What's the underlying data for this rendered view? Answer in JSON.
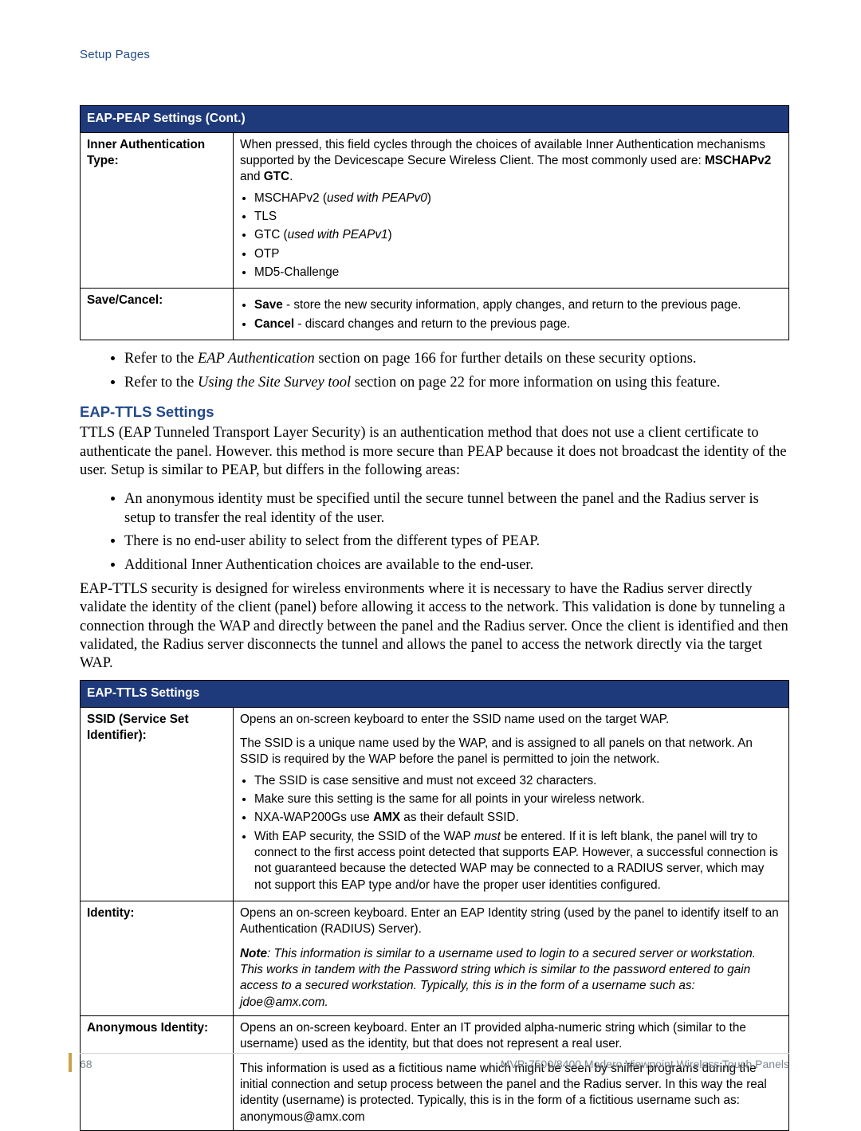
{
  "header": {
    "section_label": "Setup Pages"
  },
  "table1": {
    "title": "EAP-PEAP Settings (Cont.)",
    "rows": {
      "innerAuth": {
        "label": "Inner Authentication Type:",
        "intro_a": "When pressed, this field cycles through the choices of available Inner Authentication mechanisms supported by the Devicescape Secure Wireless Client. The most commonly used are: ",
        "intro_b1": "MSCHAPv2",
        "intro_mid": " and ",
        "intro_b2": "GTC",
        "intro_end": ".",
        "opts": {
          "o1a": "MSCHAPv2 (",
          "o1b": "used with PEAPv0",
          "o1c": ")",
          "o2": "TLS",
          "o3a": "GTC (",
          "o3b": "used with PEAPv1",
          "o3c": ")",
          "o4": "OTP",
          "o5": "MD5-Challenge"
        }
      },
      "saveCancel": {
        "label": "Save/Cancel:",
        "save_b": "Save",
        "save_rest": " - store the new security information, apply changes, and return to the previous page.",
        "cancel_b": "Cancel",
        "cancel_rest": " - discard changes and return to the previous page."
      }
    }
  },
  "afterTable1": {
    "b1a": "Refer to the ",
    "b1i": "EAP Authentication",
    "b1b": " section on page 166 for further details on these security options.",
    "b2a": "Refer to the ",
    "b2i": "Using the Site Survey tool",
    "b2b": " section on page 22 for more information on using this feature."
  },
  "section": {
    "heading": "EAP-TTLS Settings",
    "p1": "TTLS (EAP Tunneled Transport Layer Security) is an authentication method that does not use a client certificate to authenticate the panel. However. this method is more secure than PEAP because it does not broadcast the identity of the user. Setup is similar to PEAP, but differs in the following areas:",
    "b1": "An anonymous identity must be specified until the secure tunnel between the panel and the Radius server is setup to transfer the real identity of the user.",
    "b2": "There is no end-user ability to select from the different types of PEAP.",
    "b3": "Additional Inner Authentication choices are available to the end-user.",
    "p2": "EAP-TTLS security is designed for wireless environments where it is necessary to have the Radius server directly validate the identity of the client (panel) before allowing it access to the network. This validation is done by tunneling a connection through the WAP and directly between the panel and the Radius server. Once the client is identified and then validated, the Radius server disconnects the tunnel and allows the panel to access the network directly via the target WAP."
  },
  "table2": {
    "title": "EAP-TTLS Settings",
    "ssid": {
      "label": "SSID (Service Set Identifier):",
      "p1": "Opens an on-screen keyboard to enter the SSID name used on the target WAP.",
      "p2": "The SSID is a unique name used by the WAP, and is assigned to all panels on that network. An SSID is required by the WAP before the panel is permitted to join the network.",
      "li1": "The SSID is case sensitive and must not exceed 32 characters.",
      "li2": "Make sure this setting is the same for all points in your wireless network.",
      "li3a": "NXA-WAP200Gs use ",
      "li3b": "AMX",
      "li3c": " as their default SSID.",
      "li4a": "With EAP security, the SSID of the WAP ",
      "li4i": "must",
      "li4b": " be entered. If it is left blank, the panel will try to connect to the first access point detected that supports EAP. However, a successful connection is not guaranteed because the detected WAP may be connected to a RADIUS server, which may not support this EAP type and/or have the proper user identities configured."
    },
    "identity": {
      "label": "Identity:",
      "p1": "Opens an on-screen keyboard. Enter an EAP Identity string (used by the panel to identify itself to an Authentication (RADIUS) Server).",
      "note_b": "Note",
      "note_rest": ": This information is similar to a username used to login to a secured server or workstation. This works in tandem with the Password string which is similar to the password entered to gain access to a secured workstation. Typically, this is in the form of a username such as: jdoe@amx.com."
    },
    "anon": {
      "label": "Anonymous Identity:",
      "p1": "Opens an on-screen keyboard. Enter an IT provided alpha-numeric string which (similar to the username) used as the identity, but that does not represent a real user.",
      "p2": "This information is used as a fictitious name which might be seen by sniffer programs during the initial connection and setup process between the panel and the Radius server. In this way the real identity (username) is protected. Typically, this is in the form of a fictitious username such as: anonymous@amx.com"
    }
  },
  "footer": {
    "page": "68",
    "text": "MVP-7500/8400 Modero Viewpoint Wireless Touch Panels"
  }
}
